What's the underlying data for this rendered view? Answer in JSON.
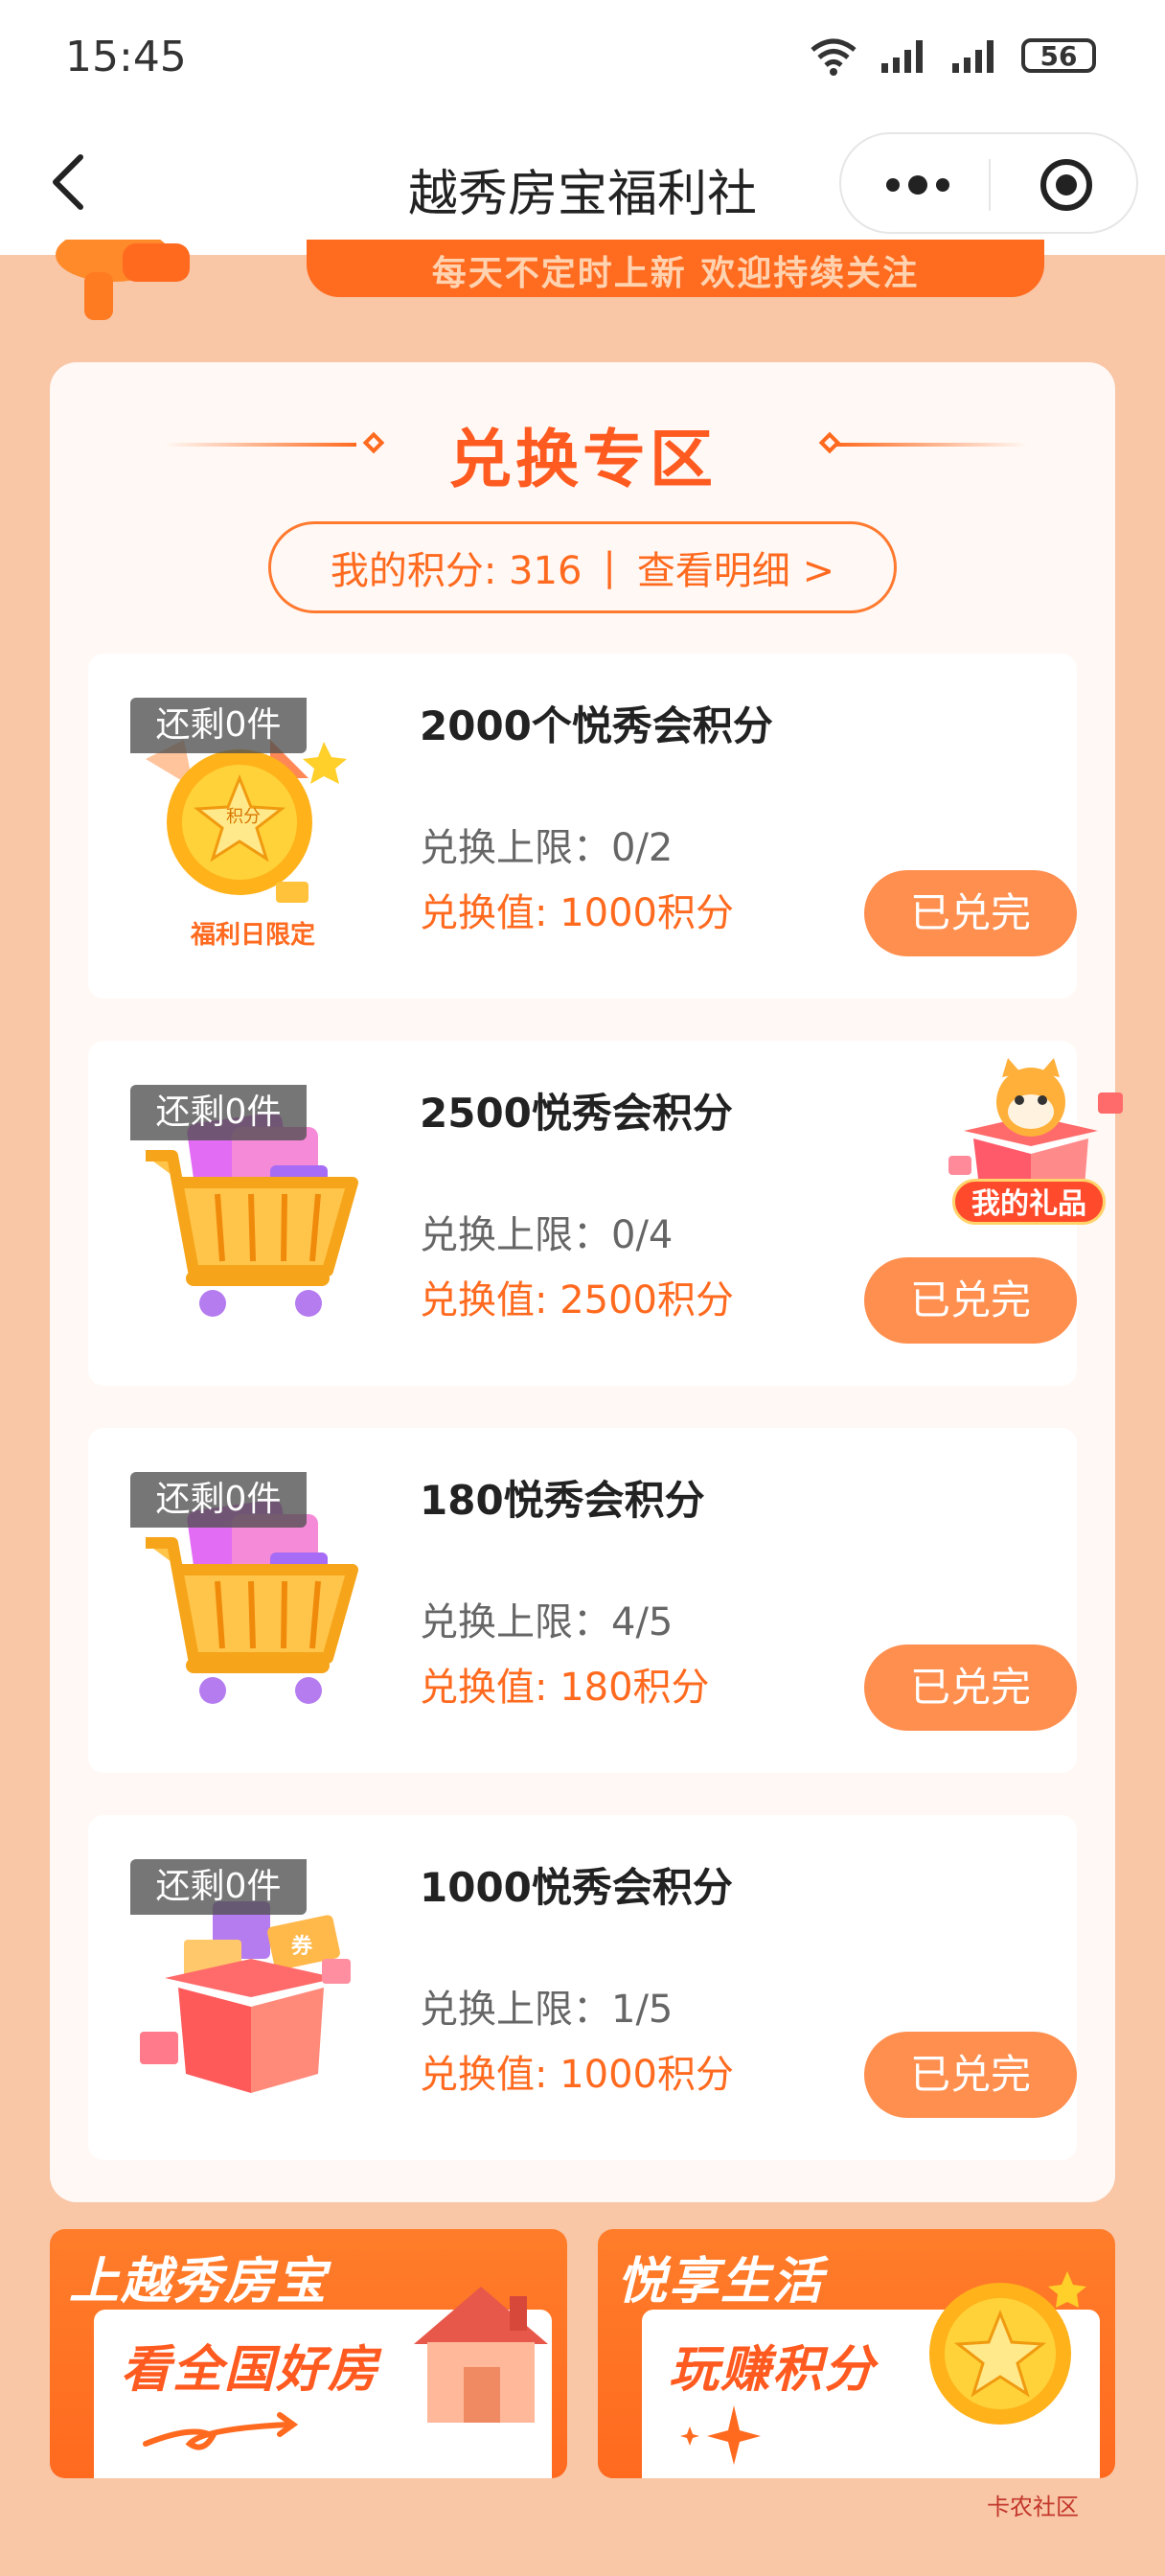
{
  "status": {
    "time": "15:45",
    "battery": "56"
  },
  "nav": {
    "title": "越秀房宝福利社"
  },
  "banner": {
    "text": "每天不定时上新 欢迎持续关注"
  },
  "section": {
    "title": "兑换专区",
    "points_label": "我的积分: 316",
    "separator": "|",
    "details_link": "查看明细 >"
  },
  "items": [
    {
      "badge": "还剩0件",
      "name": "2000个悦秀会积分",
      "limit": "兑换上限：0/2",
      "value": "兑换值: 1000积分",
      "button": "已兑完",
      "thumb_label": "福利日限定",
      "coin_label": "积分",
      "icon": "coin-icon"
    },
    {
      "badge": "还剩0件",
      "name": "2500悦秀会积分",
      "limit": "兑换上限：0/4",
      "value": "兑换值: 2500积分",
      "button": "已兑完",
      "icon": "shopping-cart-icon"
    },
    {
      "badge": "还剩0件",
      "name": "180悦秀会积分",
      "limit": "兑换上限：4/5",
      "value": "兑换值: 180积分",
      "button": "已兑完",
      "icon": "shopping-cart-icon"
    },
    {
      "badge": "还剩0件",
      "name": "1000悦秀会积分",
      "limit": "兑换上限：1/5",
      "value": "兑换值: 1000积分",
      "button": "已兑完",
      "thumb_label": "券",
      "icon": "gift-box-icon"
    }
  ],
  "gift_float": {
    "label": "我的礼品"
  },
  "promos": [
    {
      "top": "上越秀房宝",
      "bottom": "看全国好房",
      "icon": "house-icon"
    },
    {
      "top": "悦享生活",
      "bottom": "玩赚积分",
      "icon": "coin-icon"
    }
  ],
  "watermark": "卡农社区",
  "colors": {
    "accent": "#ff6a1f",
    "button": "#ff8f4f",
    "background": "#f9c6a6"
  }
}
